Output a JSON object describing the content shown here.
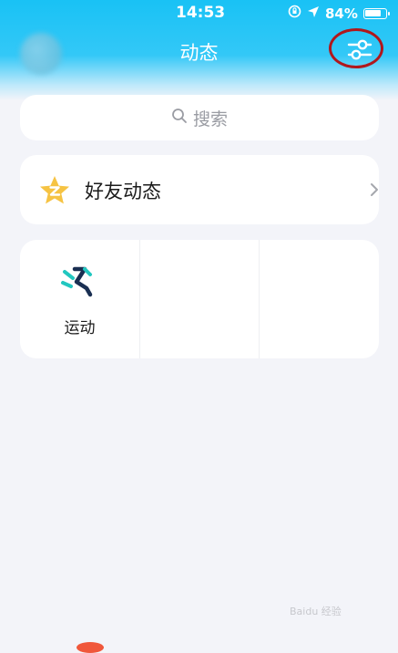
{
  "status_bar": {
    "time": "14:53",
    "battery": "84%",
    "battery_level": 0.84
  },
  "header": {
    "title": "动态"
  },
  "search": {
    "placeholder": "搜索"
  },
  "friends": {
    "label": "好友动态"
  },
  "apps": [
    {
      "label": "运动",
      "icon": "sport-running-icon"
    }
  ],
  "watermark": {
    "text": "Baidu 经验"
  },
  "colors": {
    "accent": "#19c2f5",
    "annotation": "#b0171c",
    "star": "#f6c343"
  }
}
